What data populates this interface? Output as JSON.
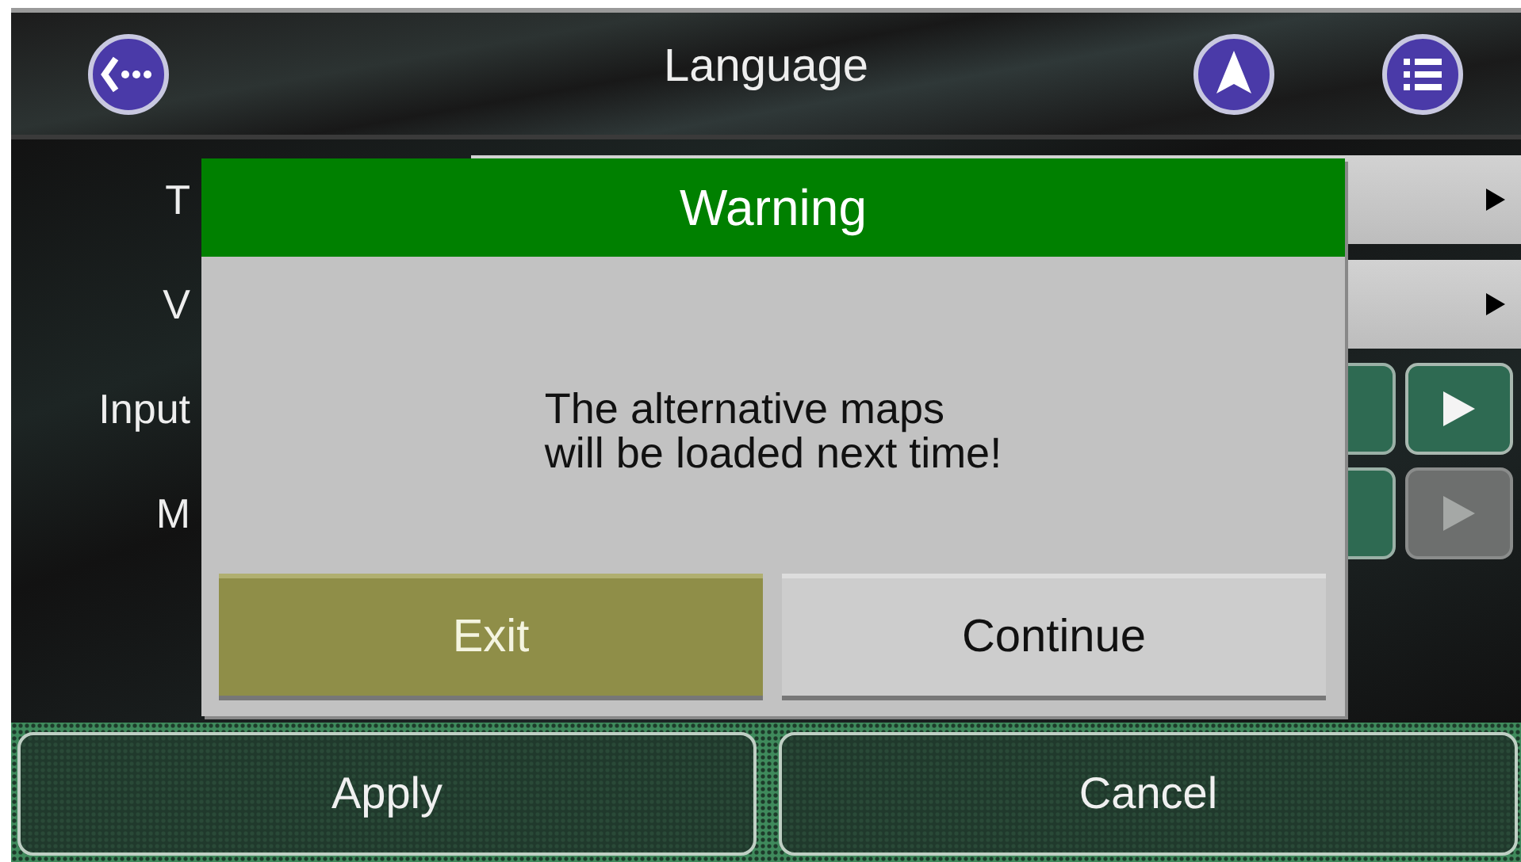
{
  "header": {
    "title": "Language"
  },
  "settings": [
    {
      "label": "T",
      "kind": "select"
    },
    {
      "label": "V",
      "kind": "select"
    },
    {
      "label": "Input",
      "kind": "stepper",
      "disabled": false
    },
    {
      "label": "M",
      "kind": "stepper",
      "disabled": true
    }
  ],
  "dialog": {
    "title": "Warning",
    "message": "The alternative maps\nwill be loaded next time!",
    "buttons": [
      {
        "label": "Exit",
        "selected": true
      },
      {
        "label": "Continue",
        "selected": false
      }
    ]
  },
  "footer": {
    "buttons": [
      "Apply",
      "Cancel"
    ]
  }
}
